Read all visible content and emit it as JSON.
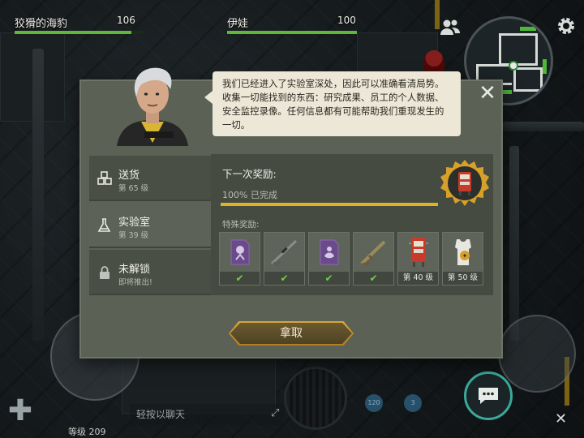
{
  "hud": {
    "player1": {
      "name": "狡猾的海豹",
      "value": "106",
      "health_fraction": 0.9
    },
    "player2": {
      "name": "伊娃",
      "value": "100",
      "health_fraction": 1.0
    },
    "level_label": "等级 209",
    "chat_placeholder": "轻按以聊天",
    "slot_counts": [
      "120",
      "3"
    ]
  },
  "dialog": {
    "speech": "我们已经进入了实验室深处，因此可以准确看清局势。收集一切能找到的东西：研究成果、员工的个人数据、安全监控录像。任何信息都有可能帮助我们重现发生的一切。",
    "tabs": [
      {
        "title": "送货",
        "subtitle": "第 65 级",
        "icon": "boxes-icon"
      },
      {
        "title": "实验室",
        "subtitle": "第 39 级",
        "icon": "flask-icon"
      },
      {
        "title": "未解锁",
        "subtitle": "即将推出!",
        "icon": "lock-icon"
      }
    ],
    "next_reward_label": "下一次奖励:",
    "progress_text": "100% 已完成",
    "progress_fraction": 1.0,
    "special_rewards_label": "特殊奖励:",
    "rewards": [
      {
        "icon": "purple-card-icon",
        "status": "claimed"
      },
      {
        "icon": "sniper-rifle-icon",
        "status": "claimed"
      },
      {
        "icon": "purple-card-icon",
        "status": "claimed"
      },
      {
        "icon": "rifle-icon",
        "status": "claimed"
      },
      {
        "icon": "red-cabinet-icon",
        "label": "第 40 级"
      },
      {
        "icon": "tank-top-icon",
        "label": "第 50 级"
      }
    ],
    "claim_label": "拿取"
  },
  "colors": {
    "accent_gold": "#e4b024",
    "health_green": "#5fb83a",
    "check_green": "#6fd04a",
    "chat_teal": "#3aa89a"
  }
}
